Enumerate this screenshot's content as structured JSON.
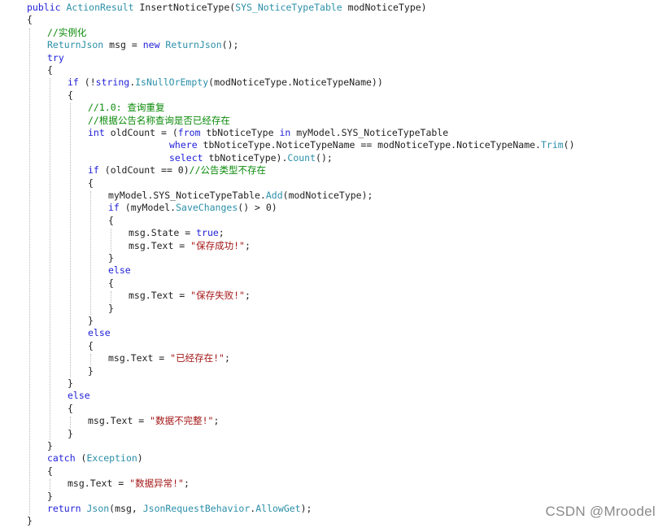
{
  "code": {
    "lines": [
      {
        "indent": 0,
        "tokens": [
          [
            "kw",
            "public "
          ],
          [
            "ty",
            "ActionResult "
          ],
          [
            "pl",
            "InsertNoticeType("
          ],
          [
            "ty",
            "SYS_NoticeTypeTable "
          ],
          [
            "pl",
            "modNoticeType)"
          ]
        ]
      },
      {
        "indent": 0,
        "tokens": [
          [
            "pl",
            "{"
          ]
        ]
      },
      {
        "indent": 1,
        "tokens": [
          [
            "cm",
            "//实例化"
          ]
        ]
      },
      {
        "indent": 1,
        "tokens": [
          [
            "ty",
            "ReturnJson "
          ],
          [
            "pl",
            "msg = "
          ],
          [
            "kw",
            "new "
          ],
          [
            "ty",
            "ReturnJson"
          ],
          [
            "pl",
            "();"
          ]
        ]
      },
      {
        "indent": 1,
        "tokens": [
          [
            "kw",
            "try"
          ]
        ]
      },
      {
        "indent": 1,
        "tokens": [
          [
            "pl",
            "{"
          ]
        ]
      },
      {
        "indent": 2,
        "tokens": [
          [
            "kw",
            "if "
          ],
          [
            "pl",
            "(!"
          ],
          [
            "kw",
            "string"
          ],
          [
            "pl",
            "."
          ],
          [
            "ty",
            "IsNullOrEmpty"
          ],
          [
            "pl",
            "(modNoticeType.NoticeTypeName))"
          ]
        ]
      },
      {
        "indent": 2,
        "tokens": [
          [
            "pl",
            "{"
          ]
        ]
      },
      {
        "indent": 3,
        "tokens": [
          [
            "cm",
            "//1.0: 查询重复"
          ]
        ]
      },
      {
        "indent": 3,
        "tokens": [
          [
            "cm",
            "//根据公告名称查询是否已经存在"
          ]
        ]
      },
      {
        "indent": 3,
        "tokens": [
          [
            "kw",
            "int "
          ],
          [
            "pl",
            "oldCount = ("
          ],
          [
            "kw",
            "from "
          ],
          [
            "pl",
            "tbNoticeType "
          ],
          [
            "kw",
            "in "
          ],
          [
            "pl",
            "myModel.SYS_NoticeTypeTable"
          ]
        ]
      },
      {
        "indent": 3,
        "pad": 8,
        "tokens": [
          [
            "kw",
            "where "
          ],
          [
            "pl",
            "tbNoticeType.NoticeTypeName == modNoticeType.NoticeTypeName."
          ],
          [
            "ty",
            "Trim"
          ],
          [
            "pl",
            "()"
          ]
        ]
      },
      {
        "indent": 3,
        "pad": 8,
        "tokens": [
          [
            "kw",
            "select "
          ],
          [
            "pl",
            "tbNoticeType)."
          ],
          [
            "ty",
            "Count"
          ],
          [
            "pl",
            "();"
          ]
        ]
      },
      {
        "indent": 3,
        "tokens": [
          [
            "kw",
            "if "
          ],
          [
            "pl",
            "(oldCount == 0)"
          ],
          [
            "cm",
            "//公告类型不存在"
          ]
        ]
      },
      {
        "indent": 3,
        "tokens": [
          [
            "pl",
            "{"
          ]
        ]
      },
      {
        "indent": 4,
        "tokens": [
          [
            "pl",
            "myModel.SYS_NoticeTypeTable."
          ],
          [
            "ty",
            "Add"
          ],
          [
            "pl",
            "(modNoticeType);"
          ]
        ]
      },
      {
        "indent": 4,
        "tokens": [
          [
            "kw",
            "if "
          ],
          [
            "pl",
            "(myModel."
          ],
          [
            "ty",
            "SaveChanges"
          ],
          [
            "pl",
            "() > 0)"
          ]
        ]
      },
      {
        "indent": 4,
        "tokens": [
          [
            "pl",
            "{"
          ]
        ]
      },
      {
        "indent": 5,
        "tokens": [
          [
            "pl",
            "msg.State = "
          ],
          [
            "kw",
            "true"
          ],
          [
            "pl",
            ";"
          ]
        ]
      },
      {
        "indent": 5,
        "tokens": [
          [
            "pl",
            "msg.Text = "
          ],
          [
            "st",
            "\"保存成功!\""
          ],
          [
            "pl",
            ";"
          ]
        ]
      },
      {
        "indent": 4,
        "tokens": [
          [
            "pl",
            "}"
          ]
        ]
      },
      {
        "indent": 4,
        "tokens": [
          [
            "kw",
            "else"
          ]
        ]
      },
      {
        "indent": 4,
        "tokens": [
          [
            "pl",
            "{"
          ]
        ]
      },
      {
        "indent": 5,
        "tokens": [
          [
            "pl",
            "msg.Text = "
          ],
          [
            "st",
            "\"保存失败!\""
          ],
          [
            "pl",
            ";"
          ]
        ]
      },
      {
        "indent": 4,
        "tokens": [
          [
            "pl",
            "}"
          ]
        ]
      },
      {
        "indent": 3,
        "tokens": [
          [
            "pl",
            "}"
          ]
        ]
      },
      {
        "indent": 3,
        "tokens": [
          [
            "kw",
            "else"
          ]
        ]
      },
      {
        "indent": 3,
        "tokens": [
          [
            "pl",
            "{"
          ]
        ]
      },
      {
        "indent": 4,
        "tokens": [
          [
            "pl",
            "msg.Text = "
          ],
          [
            "st",
            "\"已经存在!\""
          ],
          [
            "pl",
            ";"
          ]
        ]
      },
      {
        "indent": 3,
        "tokens": [
          [
            "pl",
            "}"
          ]
        ]
      },
      {
        "indent": 2,
        "tokens": [
          [
            "pl",
            "}"
          ]
        ]
      },
      {
        "indent": 2,
        "tokens": [
          [
            "kw",
            "else"
          ]
        ]
      },
      {
        "indent": 2,
        "tokens": [
          [
            "pl",
            "{"
          ]
        ]
      },
      {
        "indent": 3,
        "tokens": [
          [
            "pl",
            "msg.Text = "
          ],
          [
            "st",
            "\"数据不完整!\""
          ],
          [
            "pl",
            ";"
          ]
        ]
      },
      {
        "indent": 2,
        "tokens": [
          [
            "pl",
            "}"
          ]
        ]
      },
      {
        "indent": 1,
        "tokens": [
          [
            "pl",
            "}"
          ]
        ]
      },
      {
        "indent": 1,
        "tokens": [
          [
            "kw",
            "catch "
          ],
          [
            "pl",
            "("
          ],
          [
            "ty",
            "Exception"
          ],
          [
            "pl",
            ")"
          ]
        ]
      },
      {
        "indent": 1,
        "tokens": [
          [
            "pl",
            "{"
          ]
        ]
      },
      {
        "indent": 2,
        "tokens": [
          [
            "pl",
            "msg.Text = "
          ],
          [
            "st",
            "\"数据异常!\""
          ],
          [
            "pl",
            ";"
          ]
        ]
      },
      {
        "indent": 1,
        "tokens": [
          [
            "pl",
            "}"
          ]
        ]
      },
      {
        "indent": 1,
        "tokens": [
          [
            "kw",
            "return "
          ],
          [
            "ty",
            "Json"
          ],
          [
            "pl",
            "(msg, "
          ],
          [
            "ty",
            "JsonRequestBehavior"
          ],
          [
            "pl",
            "."
          ],
          [
            "ty",
            "AllowGet"
          ],
          [
            "pl",
            ");"
          ]
        ]
      },
      {
        "indent": 0,
        "tokens": [
          [
            "pl",
            "}"
          ]
        ]
      }
    ]
  },
  "watermark": "CSDN @Mroodel",
  "colors": {
    "keyword": "#1f1fd8",
    "type": "#2b8fa8",
    "comment": "#0a8a0a",
    "string": "#a31515",
    "plain": "#1e1e1e",
    "background": "#ffffff"
  }
}
